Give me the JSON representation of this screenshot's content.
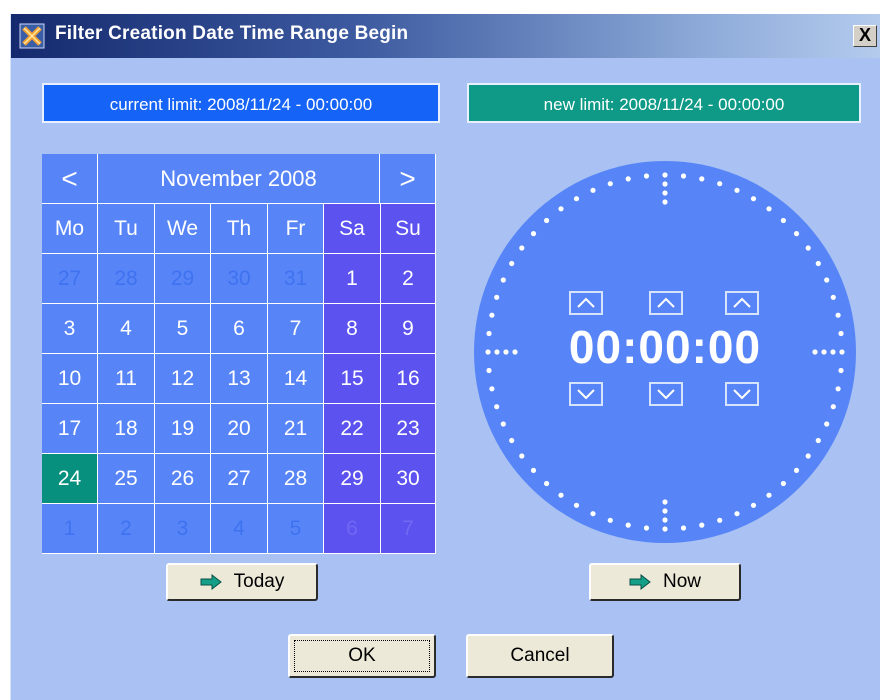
{
  "window": {
    "title": "Filter Creation Date Time Range Begin",
    "close_label": "X"
  },
  "limits": {
    "current": "current limit: 2008/11/24 - 00:00:00",
    "new": "new limit: 2008/11/24 - 00:00:00"
  },
  "calendar": {
    "prev_label": "<",
    "next_label": ">",
    "month_label": "November 2008",
    "weekdays": [
      "Mo",
      "Tu",
      "We",
      "Th",
      "Fr",
      "Sa",
      "Su"
    ],
    "weeks": [
      [
        "27",
        "28",
        "29",
        "30",
        "31",
        "1",
        "2"
      ],
      [
        "3",
        "4",
        "5",
        "6",
        "7",
        "8",
        "9"
      ],
      [
        "10",
        "11",
        "12",
        "13",
        "14",
        "15",
        "16"
      ],
      [
        "17",
        "18",
        "19",
        "20",
        "21",
        "22",
        "23"
      ],
      [
        "24",
        "25",
        "26",
        "27",
        "28",
        "29",
        "30"
      ],
      [
        "1",
        "2",
        "3",
        "4",
        "5",
        "6",
        "7"
      ]
    ],
    "selected_day": "24",
    "today_label": "Today"
  },
  "clock": {
    "hours": "00",
    "minutes": "00",
    "seconds": "00",
    "separator": ":",
    "now_label": "Now"
  },
  "dialog": {
    "ok_label": "OK",
    "cancel_label": "Cancel"
  },
  "colors": {
    "background": "#a9c2f3",
    "weekday": "#5785f7",
    "weekend": "#5b52f0",
    "selected": "#07907e"
  }
}
